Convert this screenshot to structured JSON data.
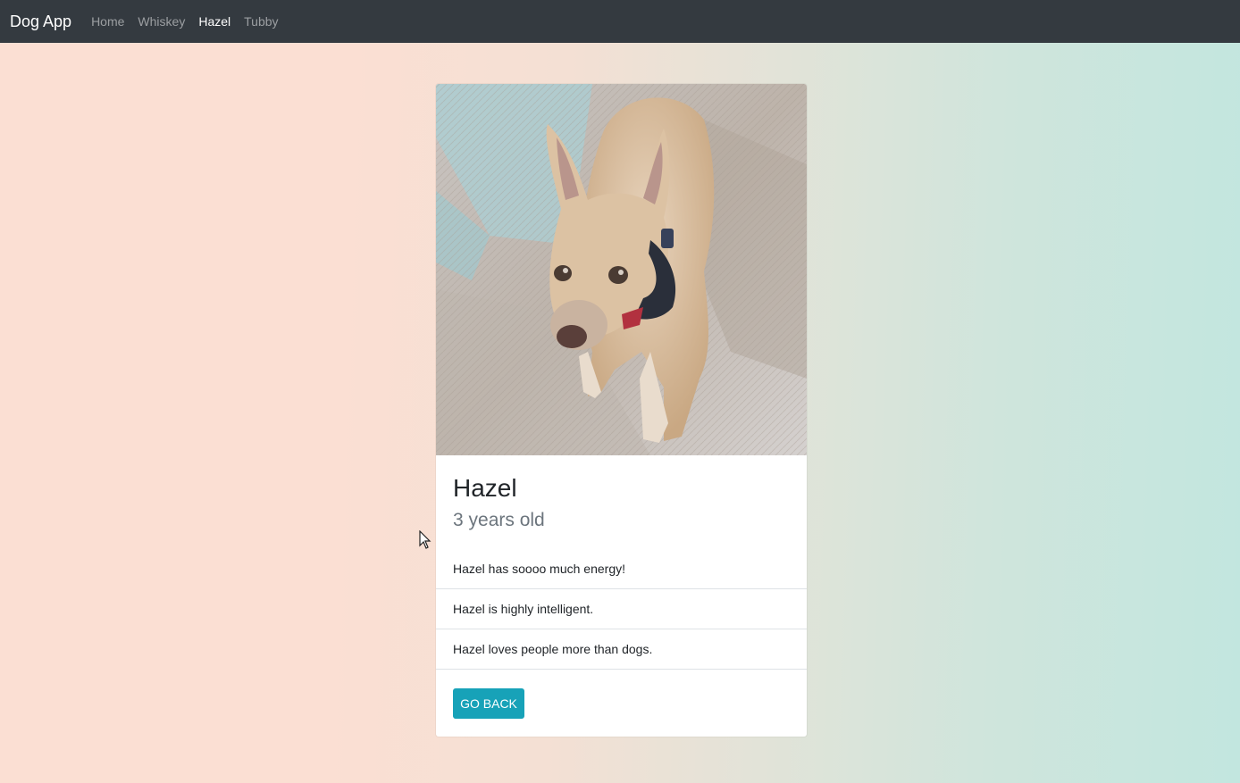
{
  "navbar": {
    "brand": "Dog App",
    "links": [
      {
        "label": "Home",
        "active": false
      },
      {
        "label": "Whiskey",
        "active": false
      },
      {
        "label": "Hazel",
        "active": true
      },
      {
        "label": "Tubby",
        "active": false
      }
    ],
    "background": "#343a40"
  },
  "dog": {
    "name": "Hazel",
    "age": "3 years old",
    "facts": [
      "Hazel has soooo much energy!",
      "Hazel is highly intelligent.",
      "Hazel loves people more than dogs."
    ],
    "photo_icon": "dog-photo"
  },
  "actions": {
    "go_back_label": "Go Back",
    "button_color": "#17a2b8"
  }
}
